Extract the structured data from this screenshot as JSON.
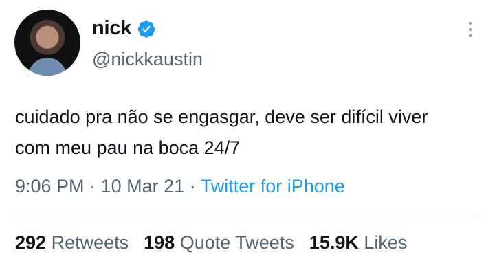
{
  "author": {
    "display_name": "nick",
    "handle": "@nickkaustin",
    "verified_icon": "verified-badge-icon",
    "badge_color": "#1d9bf0"
  },
  "tweet": {
    "text_line1": "cuidado pra não se engasgar, deve ser difícil viver",
    "text_line2": "com meu pau na boca 24/7"
  },
  "meta": {
    "time": "9:06 PM",
    "sep1": "·",
    "date": "10 Mar 21",
    "sep2": "·",
    "source": "Twitter for iPhone"
  },
  "stats": {
    "retweets_count": "292",
    "retweets_label": "Retweets",
    "quotes_count": "198",
    "quotes_label": "Quote Tweets",
    "likes_count": "15.9K",
    "likes_label": "Likes"
  },
  "icons": {
    "more": "more-vertical-icon"
  }
}
